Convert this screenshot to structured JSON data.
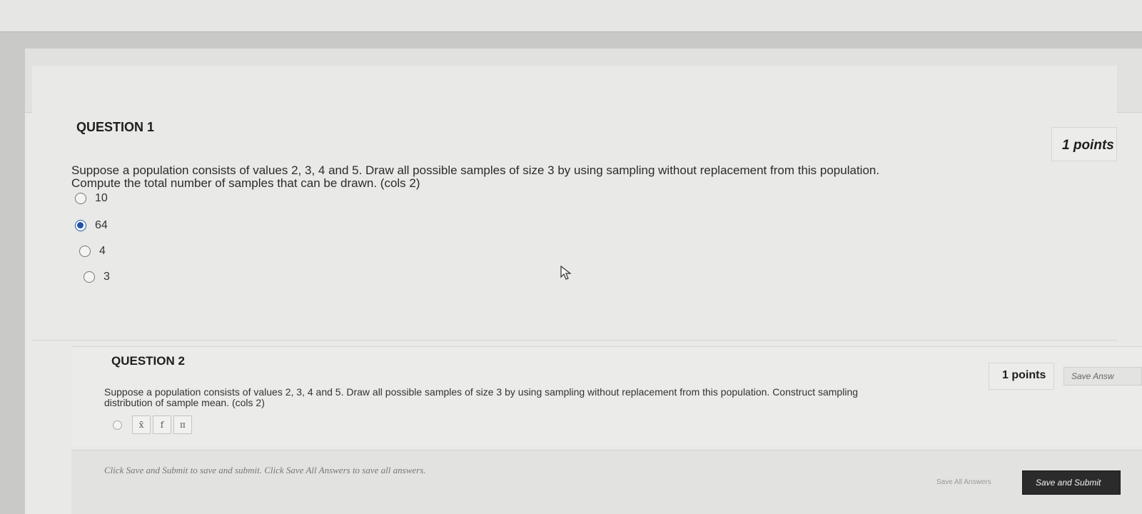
{
  "question1": {
    "title": "QUESTION 1",
    "points": "1 points",
    "text": "Suppose a population consists of values 2, 3, 4 and 5. Draw all possible samples of size 3 by using sampling without replacement from this population. Compute the total number of samples that can be drawn. (cols 2)",
    "options": [
      {
        "label": "10",
        "selected": false
      },
      {
        "label": "64",
        "selected": true
      },
      {
        "label": "4",
        "selected": false
      },
      {
        "label": "3",
        "selected": false
      }
    ]
  },
  "question2": {
    "title": "QUESTION 2",
    "points": "1 points",
    "save_answer": "Save Answ",
    "text": "Suppose a population consists of values 2, 3, 4 and 5. Draw all possible samples of size 3 by using sampling without replacement from this population. Construct sampling distribution of sample mean. (cols 2)",
    "tools": [
      "x̄",
      "f",
      "π"
    ]
  },
  "footer": {
    "note": "Click Save and Submit to save and submit. Click Save All Answers to save all answers.",
    "save_all": "Save All Answers",
    "submit": "Save and Submit"
  },
  "colors": {
    "radio_selected": "#1e55a8",
    "submit_bg": "#2b2b2b"
  }
}
